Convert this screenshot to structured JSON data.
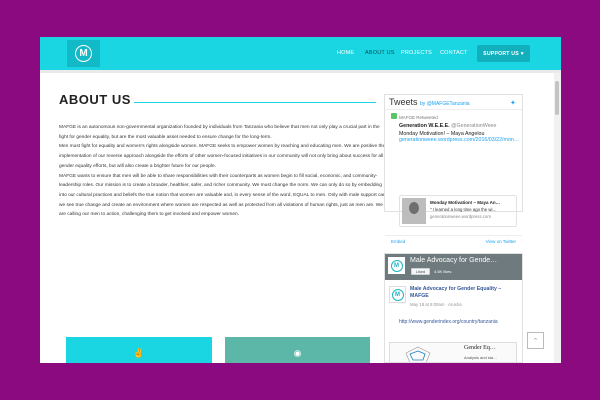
{
  "nav": {
    "logo_letter": "M",
    "links": [
      "HOME",
      "ABOUT US",
      "PROJECTS",
      "CONTACT"
    ],
    "support_label": "SUPPORT US ♥",
    "brand_color": "#1ad6e3"
  },
  "main": {
    "title": "ABOUT US",
    "paragraphs": [
      "MAFGE is an autonomous non-governmental organization founded by individuals from Tanzania who believe that men not only play a crucial part in the fight for gender equality, but are the most valuable asset needed to ensure change for the long-term.",
      "Men must fight for equality and women's rights alongside women. MAFGE seeks to empower women by reaching and educating men. We are positive the implementation of our reverse approach alongside the efforts of other women-focused initiatives in our community will not only bring about success for all gender equality efforts, but will also create a brighter future for our people.",
      "MAFGE wants to ensure that men will be able to share responsibilities with their counterparts as women begin to fill social, economic, and community-leadership roles. Our mission is to create a broader, healthier, safer, and richer community. We must change the norm. We can only do so by embedding into our cultural practices and beliefs the true notion that women are valuable and, in every sense of the word, EQUAL to men. Only with male support can we see true change and create an environment where women are respected as well as protected from all violations of human rights, just as men are. We are calling our men to action, challenging them to get involved and empower women."
    ],
    "card_icons": [
      "peace-hand-icon",
      "eye-icon"
    ]
  },
  "twitter": {
    "heading": "Tweets",
    "by": "by @MAFGETanzania",
    "retweeted": "MAFGE Retweeted",
    "author_name": "Generation W.E.E.E.",
    "author_handle": "@GenerationWeee",
    "tweet_text": "Monday Motivation! – Maya Angelou",
    "tweet_link": "generationweee.wordpress.com/2016/03/22/mon…",
    "card_title": "Monday Motivation! – Maya An…",
    "card_desc": "\" I learned a long time ago the wi…",
    "card_url": "generationweee.wordpress.com",
    "embed_label": "Embed",
    "view_label": "View on Twitter"
  },
  "facebook": {
    "page_title": "Male Advocacy for Gende…",
    "like_label": "Liked",
    "likes_count": "4.5K likes",
    "post_name": "Male Advocacy for Gender Equality – MAFGE",
    "post_date": "May 18 at 9:00am · Arusha",
    "post_link": "http://www.genderindex.org/country/tanzania",
    "image_title": "Gender Eq…",
    "image_sub": "Analysis and sta…"
  },
  "scroll_top_icon": "chevron-up-icon"
}
